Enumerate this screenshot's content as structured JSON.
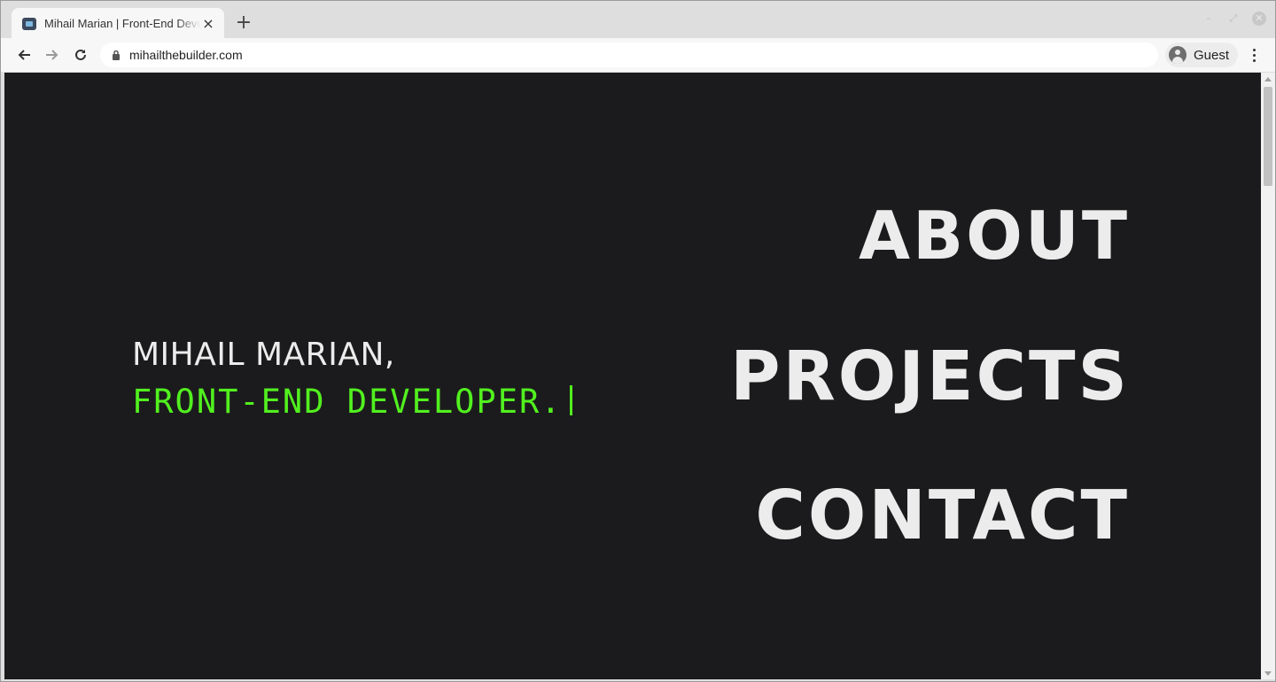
{
  "browser": {
    "tab": {
      "title": "Mihail Marian | Front-End Developer",
      "favicon": "site-favicon",
      "close_icon": "close-icon"
    },
    "new_tab_icon": "plus-icon",
    "window_controls": [
      "minimize-icon",
      "maximize-icon",
      "close-icon"
    ],
    "nav": {
      "back_icon": "arrow-left-icon",
      "forward_icon": "arrow-right-icon",
      "reload_icon": "reload-icon"
    },
    "address_bar": {
      "lock_icon": "lock-icon",
      "url": "mihailthebuilder.com"
    },
    "profile": {
      "icon": "avatar-icon",
      "label": "Guest"
    },
    "menu_icon": "kebab-menu-icon"
  },
  "page": {
    "hero": {
      "name": "MIHAIL MARIAN,",
      "role": "FRONT-END DEVELOPER."
    },
    "nav_links": {
      "about": "ABOUT",
      "projects": "PROJECTS",
      "contact": "CONTACT"
    }
  },
  "colors": {
    "background": "#1b1b1d",
    "text": "#ececec",
    "accent_green": "#52f01f",
    "chrome": "#dedede"
  }
}
